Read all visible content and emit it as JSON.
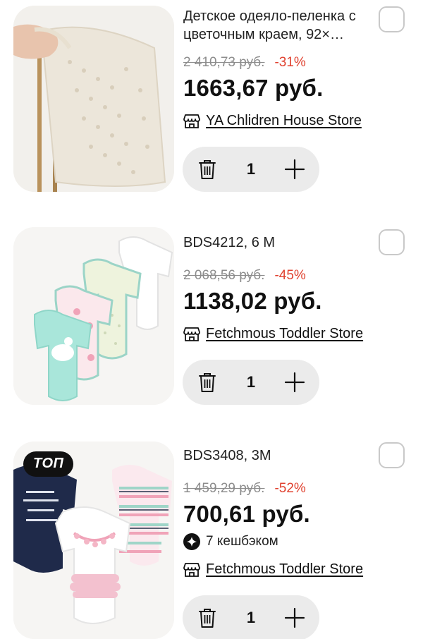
{
  "cart_items": [
    {
      "title": "Детское одеяло-пеленка с цветочным краем, 92×…",
      "old_price": "2 410,73 руб.",
      "discount": "-31%",
      "price": "1663,67 руб.",
      "store": "YA Chlidren House Store",
      "quantity": "1",
      "selected": false,
      "photo_icon": "knit-blanket-photo"
    },
    {
      "title": "BDS4212, 6 M",
      "old_price": "2 068,56 руб.",
      "discount": "-45%",
      "price": "1138,02 руб.",
      "store": "Fetchmous Toddler Store",
      "quantity": "1",
      "selected": false,
      "photo_icon": "baby-bodysuits-photo"
    },
    {
      "title": "BDS3408, 3M",
      "old_price": "1 459,29 руб.",
      "discount": "-52%",
      "price": "700,61 руб.",
      "cashback": "7 кешбэком",
      "store": "Fetchmous Toddler Store",
      "quantity": "1",
      "selected": false,
      "badge": "ТОП",
      "photo_icon": "baby-bodysuits-photo"
    }
  ],
  "colors": {
    "discount": "#e0402e",
    "old_price": "#8c8c8c",
    "stepper_bg": "#ebebeb",
    "badge_bg": "#111111"
  }
}
